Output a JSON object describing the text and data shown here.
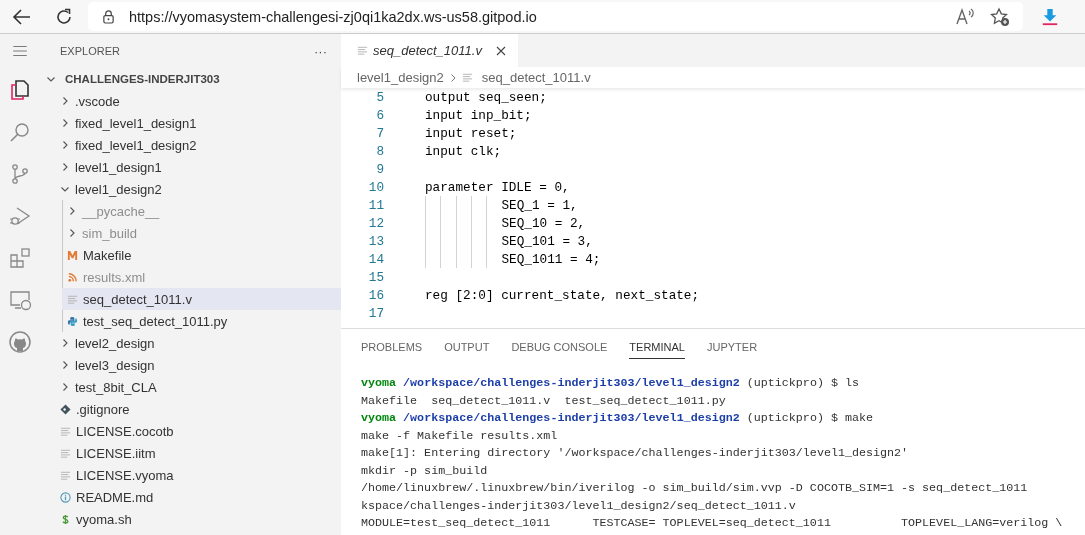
{
  "browser": {
    "url": "https://vyomasystem-challengesi-zj0qi1ka2dx.ws-us58.gitpod.io"
  },
  "explorer": {
    "title": "EXPLORER",
    "more": "···",
    "root": {
      "label": "CHALLENGES-INDERJIT303",
      "expanded": true
    },
    "items": [
      {
        "kind": "folder",
        "label": ".vscode",
        "expanded": false,
        "selected": false,
        "dimmed": false
      },
      {
        "kind": "folder",
        "label": "fixed_level1_design1",
        "expanded": false,
        "selected": false,
        "dimmed": false
      },
      {
        "kind": "folder",
        "label": "fixed_level1_design2",
        "expanded": false,
        "selected": false,
        "dimmed": false
      },
      {
        "kind": "folder",
        "label": "level1_design1",
        "expanded": false,
        "selected": false,
        "dimmed": false
      },
      {
        "kind": "folder",
        "label": "level1_design2",
        "expanded": true,
        "selected": false,
        "dimmed": false,
        "children": [
          {
            "kind": "folder",
            "label": "__pycache__",
            "expanded": false,
            "selected": false,
            "dimmed": true
          },
          {
            "kind": "folder",
            "label": "sim_build",
            "expanded": false,
            "selected": false,
            "dimmed": true
          },
          {
            "kind": "makefile",
            "label": "Makefile",
            "selected": false,
            "dimmed": false
          },
          {
            "kind": "feed",
            "label": "results.xml",
            "selected": false,
            "dimmed": true
          },
          {
            "kind": "text",
            "label": "seq_detect_1011.v",
            "selected": true,
            "dimmed": false
          },
          {
            "kind": "python",
            "label": "test_seq_detect_1011.py",
            "selected": false,
            "dimmed": false
          }
        ]
      },
      {
        "kind": "folder",
        "label": "level2_design",
        "expanded": false,
        "selected": false,
        "dimmed": false
      },
      {
        "kind": "folder",
        "label": "level3_design",
        "expanded": false,
        "selected": false,
        "dimmed": false
      },
      {
        "kind": "folder",
        "label": "test_8bit_CLA",
        "expanded": false,
        "selected": false,
        "dimmed": false
      },
      {
        "kind": "git",
        "label": ".gitignore",
        "selected": false,
        "dimmed": false
      },
      {
        "kind": "text",
        "label": "LICENSE.cocotb",
        "selected": false,
        "dimmed": false
      },
      {
        "kind": "text",
        "label": "LICENSE.iitm",
        "selected": false,
        "dimmed": false
      },
      {
        "kind": "text",
        "label": "LICENSE.vyoma",
        "selected": false,
        "dimmed": false
      },
      {
        "kind": "info",
        "label": "README.md",
        "selected": false,
        "dimmed": false
      },
      {
        "kind": "shell",
        "label": "vyoma.sh",
        "selected": false,
        "dimmed": false
      }
    ]
  },
  "editor": {
    "tabs": [
      {
        "label": "seq_detect_1011.v",
        "selected": true
      }
    ],
    "breadcrumb": [
      "level1_design2",
      "seq_detect_1011.v"
    ],
    "lines": [
      {
        "number": "5",
        "text": "output seq_seen;",
        "indented": false
      },
      {
        "number": "6",
        "text": "input inp_bit;",
        "indented": false
      },
      {
        "number": "7",
        "text": "input reset;",
        "indented": false
      },
      {
        "number": "8",
        "text": "input clk;",
        "indented": false
      },
      {
        "number": "9",
        "indented": false
      },
      {
        "number": "10",
        "text": "parameter IDLE = 0,",
        "indented": false
      },
      {
        "number": "11",
        "text": "SEQ_1 = 1,",
        "indented": true
      },
      {
        "number": "12",
        "text": "SEQ_10 = 2,",
        "indented": true
      },
      {
        "number": "13",
        "text": "SEQ_101 = 3,",
        "indented": true
      },
      {
        "number": "14",
        "text": "SEQ_1011 = 4;",
        "indented": true
      },
      {
        "number": "15",
        "indented": false
      },
      {
        "number": "16",
        "text": "reg [2:0] current_state, next_state;",
        "indented": false
      },
      {
        "number": "17",
        "indented": false
      }
    ]
  },
  "panel": {
    "tabs": [
      {
        "label": "PROBLEMS",
        "selected": false
      },
      {
        "label": "OUTPUT",
        "selected": false
      },
      {
        "label": "DEBUG CONSOLE",
        "selected": false
      },
      {
        "label": "TERMINAL",
        "selected": true
      },
      {
        "label": "JUPYTER",
        "selected": false
      }
    ],
    "terminal": [
      {
        "kind": "prompt",
        "user": "vyoma",
        "path": "/workspace/challenges-inderjit303/level1_design2",
        "rest": "(uptickpro) $ ls"
      },
      {
        "kind": "output",
        "text": "Makefile  seq_detect_1011.v  test_seq_detect_1011.py"
      },
      {
        "kind": "prompt",
        "user": "vyoma",
        "path": "/workspace/challenges-inderjit303/level1_design2",
        "rest": "(uptickpro) $ make"
      },
      {
        "kind": "output",
        "text": "make -f Makefile results.xml"
      },
      {
        "kind": "output",
        "text": "make[1]: Entering directory '/workspace/challenges-inderjit303/level1_design2'"
      },
      {
        "kind": "output",
        "text": "mkdir -p sim_build"
      },
      {
        "kind": "output",
        "text": "/home/linuxbrew/.linuxbrew/bin/iverilog -o sim_build/sim.vvp -D COCOTB_SIM=1 -s seq_detect_1011"
      },
      {
        "kind": "output",
        "text": "kspace/challenges-inderjit303/level1_design2/seq_detect_1011.v"
      },
      {
        "kind": "output",
        "text": "MODULE=test_seq_detect_1011      TESTCASE= TOPLEVEL=seq_detect_1011          TOPLEVEL_LANG=verilog \\"
      }
    ]
  }
}
